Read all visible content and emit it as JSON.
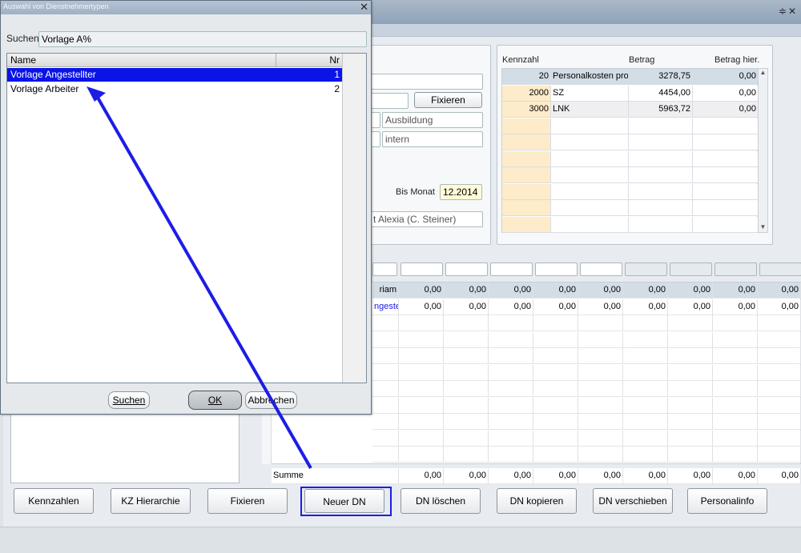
{
  "main": {
    "right_grid": {
      "headers": [
        "Kennzahl",
        "Betrag",
        "Betrag hier."
      ],
      "rows": [
        {
          "key": "20",
          "name": "Personalkosten pro",
          "betrag": "3278,75",
          "hier": "0,00"
        },
        {
          "key": "2000",
          "name": "SZ",
          "betrag": "4454,00",
          "hier": "0,00"
        },
        {
          "key": "3000",
          "name": "LNK",
          "betrag": "5963,72",
          "hier": "0,00"
        }
      ]
    },
    "form": {
      "fixieren_label": "Fixieren",
      "ausbildung_placeholder": "Ausbildung",
      "intern_placeholder": "intern",
      "bis_monat_label": "Bis Monat",
      "bis_monat_value": "12.2014",
      "person_value": "t Alexia (C. Steiner)"
    },
    "lower_grid": {
      "row1_label": "riam",
      "row2_label": "ngeste",
      "row1_values": [
        "0,00",
        "0,00",
        "0,00",
        "0,00",
        "0,00",
        "0,00",
        "0,00",
        "0,00",
        "0,00"
      ],
      "row2_values": [
        "0,00",
        "0,00",
        "0,00",
        "0,00",
        "0,00",
        "0,00",
        "0,00",
        "0,00",
        "0,00"
      ],
      "summe_label": "Summe",
      "summe_values": [
        "0,00",
        "0,00",
        "0,00",
        "0,00",
        "0,00",
        "0,00",
        "0,00",
        "0,00",
        "0,00"
      ]
    },
    "buttons": {
      "kennzahlen": "Kennzahlen",
      "kz_hierarchie": "KZ Hierarchie",
      "fixieren": "Fixieren",
      "neuer_dn": "Neuer DN",
      "dn_loeschen": "DN löschen",
      "dn_kopieren": "DN kopieren",
      "dn_verschieben": "DN verschieben",
      "personalinfo": "Personalinfo"
    }
  },
  "dialog": {
    "title": "Auswahl von Dienstnehmertypen",
    "search_label": "Suchen",
    "search_value": "Vorlage A%",
    "columns": [
      "Name",
      "Nr"
    ],
    "rows": [
      {
        "name": "Vorlage Angestellter",
        "nr": "1",
        "selected": true
      },
      {
        "name": "Vorlage Arbeiter",
        "nr": "2",
        "selected": false
      }
    ],
    "buttons": {
      "suchen": "Suchen",
      "ok": "OK",
      "abbrechen": "Abbrechen"
    }
  },
  "colors": {
    "annotation_arrow": "#1d1de6",
    "selection": "#0a14e8",
    "key_cell": "#fdebc9"
  }
}
